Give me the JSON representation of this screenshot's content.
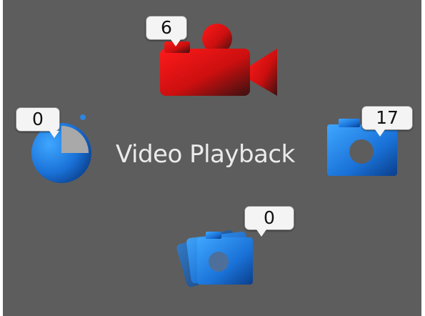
{
  "center_label": "Video Playback",
  "modes": {
    "video": {
      "icon": "video-camera-icon",
      "count": "6",
      "color_start": "#ff1a1a",
      "color_end": "#4a1111"
    },
    "timer": {
      "icon": "timer-icon",
      "count": "0",
      "color_start": "#3fa7ff",
      "color_end": "#0a3e8a"
    },
    "camera": {
      "icon": "camera-icon",
      "count": "17",
      "color_start": "#3fa7ff",
      "color_end": "#0a3e8a"
    },
    "burst": {
      "icon": "burst-photo-icon",
      "count": "0",
      "color_start": "#3fa7ff",
      "color_end": "#0a3e8a"
    }
  }
}
